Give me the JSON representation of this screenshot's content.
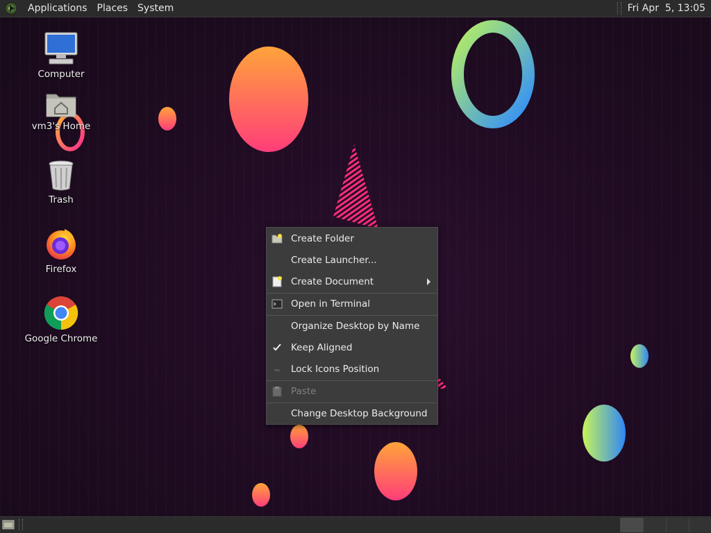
{
  "top_panel": {
    "menus": [
      "Applications",
      "Places",
      "System"
    ],
    "clock": "Fri Apr  5, 13:05"
  },
  "desktop_icons": [
    {
      "label": "Computer",
      "icon": "computer-icon"
    },
    {
      "label": "vm3's Home",
      "icon": "home-folder-icon"
    },
    {
      "label": "Trash",
      "icon": "trash-icon"
    },
    {
      "label": "Firefox",
      "icon": "firefox-icon"
    },
    {
      "label": "Google Chrome",
      "icon": "chrome-icon"
    }
  ],
  "context_menu": {
    "items": [
      {
        "label": "Create Folder",
        "icon": "new-folder-icon",
        "enabled": true
      },
      {
        "label": "Create Launcher...",
        "icon": "",
        "enabled": true
      },
      {
        "label": "Create Document",
        "icon": "new-document-icon",
        "enabled": true,
        "submenu": true
      },
      {
        "label": "Open in Terminal",
        "icon": "terminal-icon",
        "enabled": true
      },
      {
        "label": "Organize Desktop by Name",
        "icon": "",
        "enabled": true
      },
      {
        "label": "Keep Aligned",
        "icon": "checkmark-icon",
        "enabled": true,
        "checked": true
      },
      {
        "label": "Lock Icons Position",
        "icon": "checkbox-icon",
        "enabled": true,
        "checked": false
      },
      {
        "label": "Paste",
        "icon": "paste-icon",
        "enabled": false
      },
      {
        "label": "Change Desktop Background",
        "icon": "",
        "enabled": true
      }
    ]
  },
  "bottom_panel": {
    "show_desktop_icon": "show-desktop-icon",
    "workspaces": 4,
    "active_workspace": 1
  },
  "colors": {
    "panel_bg": "#2b2b2b",
    "menu_bg": "#3c3c3c",
    "desktop_bg": "#1f0b22",
    "accent_orange": "#ff8a3d",
    "accent_pink": "#ff3d7f"
  }
}
